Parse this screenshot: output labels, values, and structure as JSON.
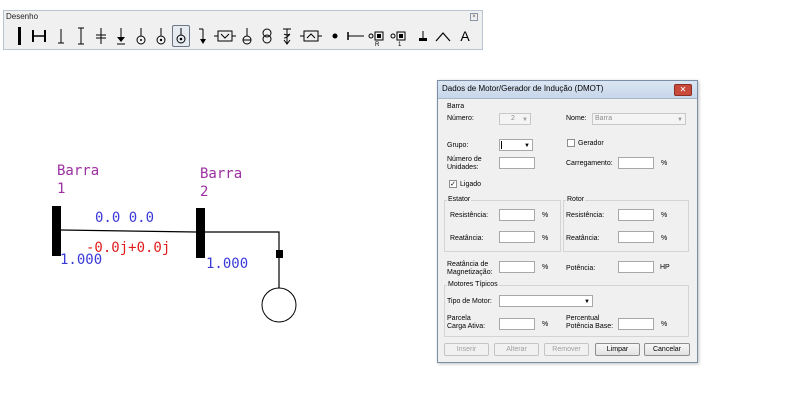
{
  "toolbar": {
    "title": "Desenho",
    "text_tool": "A",
    "icons": [
      "bar-vertical-icon",
      "bar-horizontal-icon",
      "line-terminal-down-icon",
      "line-terminal-both-icon",
      "capacitor-icon",
      "ground-arrow-icon",
      "generator-icon",
      "motor-icon",
      "load-icon",
      "arrow-down-icon",
      "series-element-icon",
      "shunt-element-icon",
      "transformer-icon",
      "three-winding-icon",
      "compensator-icon",
      "dot-node-icon",
      "line-icon",
      "resistor-r-icon",
      "resistor-1-icon",
      "ground-icon",
      "ramp-icon",
      "text-icon"
    ]
  },
  "diagram": {
    "bus1": {
      "name": "Barra",
      "number": "1",
      "voltage": "1.000"
    },
    "bus2": {
      "name": "Barra",
      "number": "2",
      "voltage": "1.000"
    },
    "flow_top": "0.0 0.0",
    "flow_bottom": "-0.0j+0.0j",
    "colors": {
      "bus_label": "#9c2fa2",
      "voltage": "#3a3ad8",
      "flow_top": "#3a3ad8",
      "flow_bottom": "#e01e1e"
    }
  },
  "dialog": {
    "title": "Dados de Motor/Gerador de Indução (DMOT)",
    "close_label": "✕",
    "barra": {
      "section": "Barra",
      "numero_label": "Número:",
      "numero_value": "2",
      "nome_label": "Nome:",
      "nome_value": "Barra"
    },
    "grupo_label": "Grupo:",
    "grupo_value": "",
    "gerador_label": "Gerador",
    "gerador_checked": false,
    "unidades_label_1": "Número de",
    "unidades_label_2": "Unidades:",
    "carregamento_label": "Carregamento:",
    "carregamento_unit": "%",
    "ligado_label": "Ligado",
    "ligado_checked": true,
    "estator": {
      "section": "Estator",
      "resistencia_label": "Resistência:",
      "resistencia_unit": "%",
      "reatancia_label": "Reatância:",
      "reatancia_unit": "%"
    },
    "rotor": {
      "section": "Rotor",
      "resistencia_label": "Resistência:",
      "resistencia_unit": "%",
      "reatancia_label": "Reatância:",
      "reatancia_unit": "%"
    },
    "magnetizacao_label_1": "Reatância de",
    "magnetizacao_label_2": "Magnetização:",
    "magnetizacao_unit": "%",
    "potencia_label": "Potência:",
    "potencia_unit": "HP",
    "motores": {
      "section": "Motores Típicos",
      "tipo_label": "Tipo de Motor:",
      "tipo_value": "",
      "parcela_label_1": "Parcela",
      "parcela_label_2": "Carga Ativa:",
      "parcela_unit": "%",
      "percentual_label_1": "Percentual",
      "percentual_label_2": "Potência Base:",
      "percentual_unit": "%"
    },
    "buttons": {
      "inserir": "Inserir",
      "alterar": "Alterar",
      "remover": "Remover",
      "limpar": "Limpar",
      "cancelar": "Cancelar"
    }
  }
}
